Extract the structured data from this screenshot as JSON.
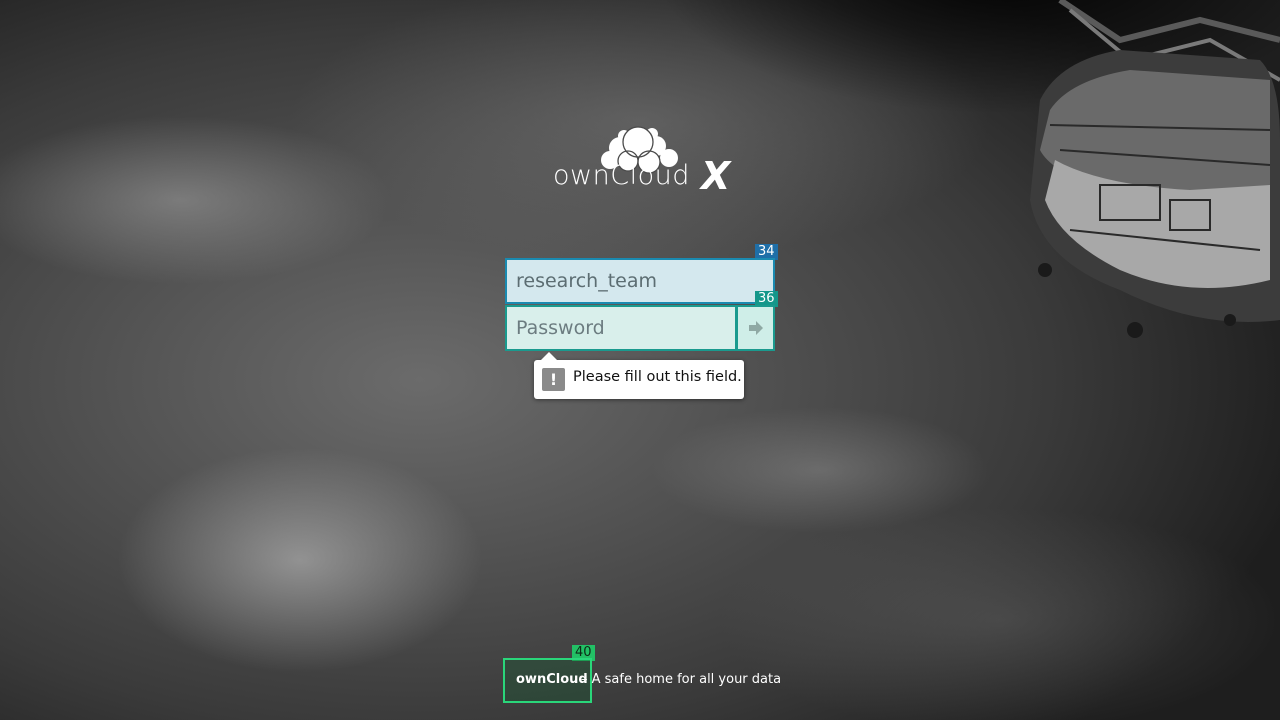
{
  "app": {
    "logo_text": "ownCloud",
    "logo_suffix": "X"
  },
  "login": {
    "username_value": "research_team",
    "password_placeholder": "Password",
    "submit_icon": "arrow-right-icon"
  },
  "validation": {
    "message": "Please fill out this field.",
    "icon": "exclamation-icon"
  },
  "badges": {
    "username": "34",
    "password": "36",
    "footer": "40"
  },
  "footer": {
    "brand": "ownCloud",
    "tagline": "– A safe home for all your data"
  },
  "colors": {
    "field_border": "#1a8ab0",
    "field_border_alt": "#1a9a8e",
    "footer_focus": "#2ad67a"
  }
}
